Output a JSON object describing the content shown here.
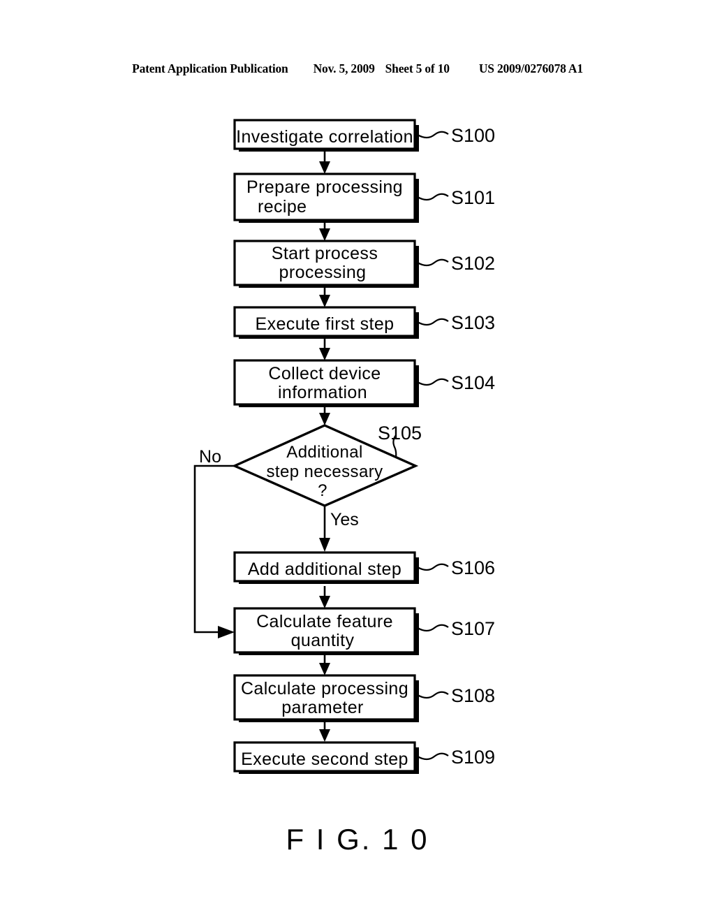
{
  "header": {
    "publication": "Patent Application Publication",
    "date": "Nov. 5, 2009",
    "sheet": "Sheet 5 of 10",
    "patent_number": "US 2009/0276078 A1"
  },
  "figure": {
    "caption": "F I G. 1 0"
  },
  "flowchart": {
    "type": "flowchart",
    "nodes": [
      {
        "id": "S100",
        "shape": "process",
        "lines": [
          "Investigate  correlation"
        ],
        "label": "S100"
      },
      {
        "id": "S101",
        "shape": "process",
        "lines": [
          "Prepare  processing",
          "recipe"
        ],
        "label": "S101"
      },
      {
        "id": "S102",
        "shape": "process",
        "lines": [
          "Start  process",
          "processing"
        ],
        "label": "S102"
      },
      {
        "id": "S103",
        "shape": "process",
        "lines": [
          "Execute  first  step"
        ],
        "label": "S103"
      },
      {
        "id": "S104",
        "shape": "process",
        "lines": [
          "Collect  device",
          "information"
        ],
        "label": "S104"
      },
      {
        "id": "S105",
        "shape": "decision",
        "lines": [
          "Additional",
          "step  necessary",
          "?"
        ],
        "label": "S105"
      },
      {
        "id": "S106",
        "shape": "process",
        "lines": [
          "Add  additional  step"
        ],
        "label": "S106"
      },
      {
        "id": "S107",
        "shape": "process",
        "lines": [
          "Calculate  feature",
          "quantity"
        ],
        "label": "S107"
      },
      {
        "id": "S108",
        "shape": "process",
        "lines": [
          "Calculate  processing",
          "parameter"
        ],
        "label": "S108"
      },
      {
        "id": "S109",
        "shape": "process",
        "lines": [
          "Execute  second  step"
        ],
        "label": "S109"
      }
    ],
    "branches": {
      "no_label": "No",
      "yes_label": "Yes"
    },
    "edges": [
      {
        "from": "S100",
        "to": "S101"
      },
      {
        "from": "S101",
        "to": "S102"
      },
      {
        "from": "S102",
        "to": "S103"
      },
      {
        "from": "S103",
        "to": "S104"
      },
      {
        "from": "S104",
        "to": "S105"
      },
      {
        "from": "S105",
        "to": "S106",
        "label": "Yes"
      },
      {
        "from": "S105",
        "to": "S107",
        "label": "No"
      },
      {
        "from": "S106",
        "to": "S107"
      },
      {
        "from": "S107",
        "to": "S108"
      },
      {
        "from": "S108",
        "to": "S109"
      }
    ]
  }
}
